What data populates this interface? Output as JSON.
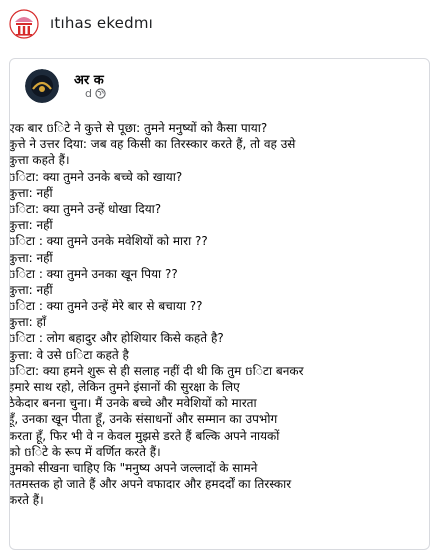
{
  "header": {
    "group_name": "ıtıhas ekedmı",
    "logo_icon": "group-emblem-icon"
  },
  "post": {
    "author": "अर क",
    "meta_time": "d",
    "privacy_icon": "globe-icon",
    "lines": [
      "एक बार ចिटे ने कुत्ते से पूछा: तुमने मनुष्यों को कैसा पाया?",
      "कुत्ते ने उत्तर दिया: जब वह किसी का तिरस्कार करते हैं, तो वह उसे",
      "कुत्ता कहते हैं।",
      "ចिटा: क्या तुमने उनके बच्चे को खाया?",
      "कुत्ता: नहीं",
      "ចिटा: क्या तुमने उन्हें धोखा दिया?",
      "कुत्ता: नहीं",
      "ចिटा : क्या तुमने उनके मवेशियों को मारा ??",
      "कुत्ता: नहीं",
      "ចिटा : क्या तुमने उनका खून पिया ??",
      "कुत्ता: नहीं",
      "ចिटा : क्या तुमने उन्हें मेरे बार से बचाया ??",
      "कुत्ता: हाँ",
      "ចिटा : लोग बहादुर और होशियार किसे कहते है?",
      "कुत्ता: वे उसे ចिटा कहते है",
      "ចिटा: क्या हमने शुरू से ही सलाह नहीं दी थी कि तुम ចिटा बनकर",
      "हमारे साथ रहो, लेकिन तुमने इंसानों की सुरक्षा के लिए",
      "ठेकेदार बनना चुना। मैं उनके बच्चे और मवेशियों को मारता",
      "हूँ, उनका खून पीता हूँ, उनके संसाधनों और सम्मान का उपभोग",
      "करता हूँ, फिर भी वे न केवल मुझसे डरते हैं बल्कि अपने नायकों",
      "को ចिटे के रूप में वर्णित करते हैं।",
      "तुमको सीखना चाहिए कि \"मनुष्य अपने जल्लादों के सामने",
      "नतमस्तक हो जाते हैं और अपने वफादार और हमदर्दों का तिरस्कार",
      "करते हैं।"
    ]
  },
  "colors": {
    "border": "#d8dadf",
    "text": "#050505",
    "meta": "#65676b",
    "logo_red": "#d62a2a",
    "logo_pink": "#e27b9e",
    "avatar_dark": "#1d2a3a",
    "avatar_gold": "#d6a63a"
  }
}
